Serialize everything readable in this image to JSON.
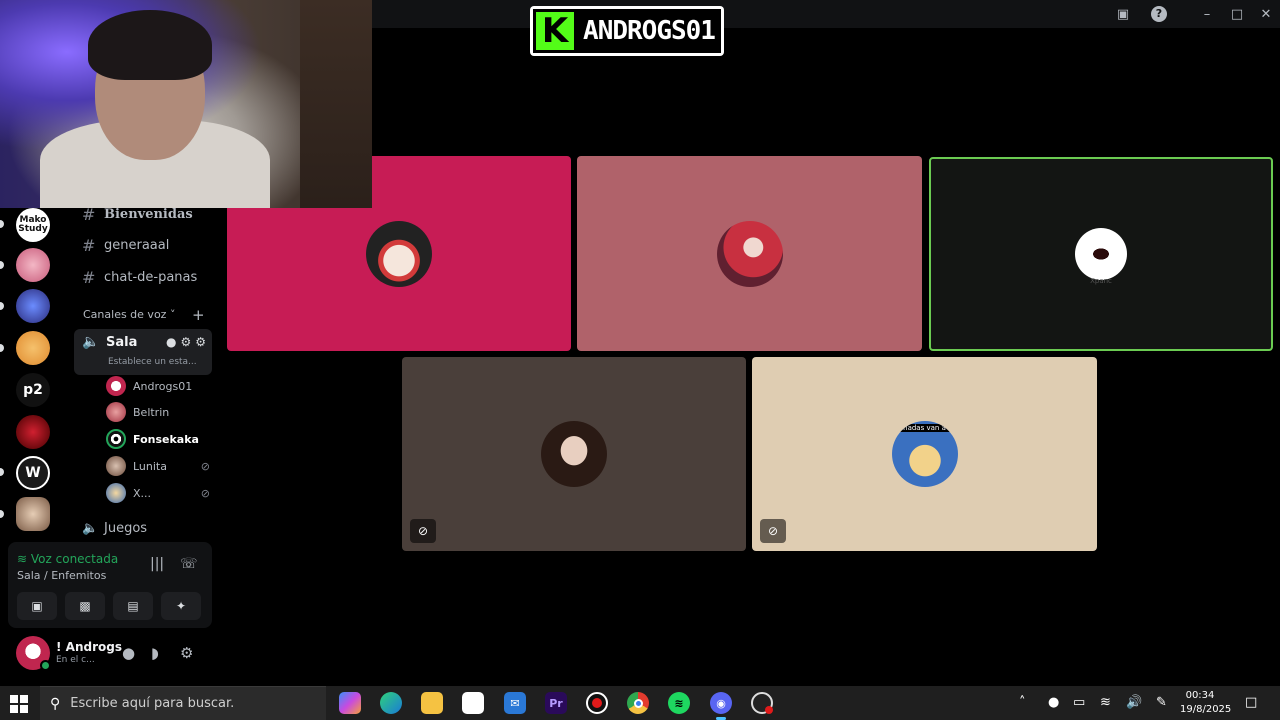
{
  "logo": {
    "letter": "K",
    "text": "ANDROGS01"
  },
  "titlebar": {
    "inbox_icon": "inbox-icon",
    "help_icon": "help-icon"
  },
  "channels": [
    {
      "name": "Bienvenidas",
      "icon": "hash-icon"
    },
    {
      "name": "generaaal",
      "icon": "hash-icon"
    },
    {
      "name": "chat-de-panas",
      "icon": "hash-icon"
    }
  ],
  "voice_category": {
    "label": "Canales de voz",
    "add": "+"
  },
  "sala": {
    "name": "Sala",
    "status": "Establece un esta..."
  },
  "voice_users": [
    {
      "name": "Androgs01",
      "muted": false,
      "bold": false
    },
    {
      "name": "Beltrin",
      "muted": false,
      "bold": false
    },
    {
      "name": "Fonsekaka",
      "muted": false,
      "bold": true
    },
    {
      "name": "Lunita",
      "muted": true,
      "bold": false
    },
    {
      "name": "X...",
      "muted": true,
      "bold": false
    }
  ],
  "other_channel": {
    "name": "Juegos"
  },
  "rail": {
    "servers": [
      "Mako Study",
      "p2"
    ]
  },
  "voice_panel": {
    "title": "Voz conectada",
    "subtitle": "Sala / Enfemitos"
  },
  "user_panel": {
    "name": "! Androgs",
    "status": "En el c..."
  },
  "tiles": {
    "tile3_caption": "Xpanc",
    "tile5_caption": "nadas van a"
  },
  "taskbar": {
    "search_placeholder": "Escribe aquí para buscar.",
    "time": "00:34",
    "date": "19/8/2025",
    "premiere_label": "Pr"
  },
  "colors": {
    "tile1": "#c71c55",
    "tile2": "#b0626a",
    "tile3": "#131513",
    "tile3_border": "#6bcb52",
    "tile4": "#4a3f3a",
    "tile5": "#dfcdb2",
    "kick_green": "#53fc18"
  }
}
